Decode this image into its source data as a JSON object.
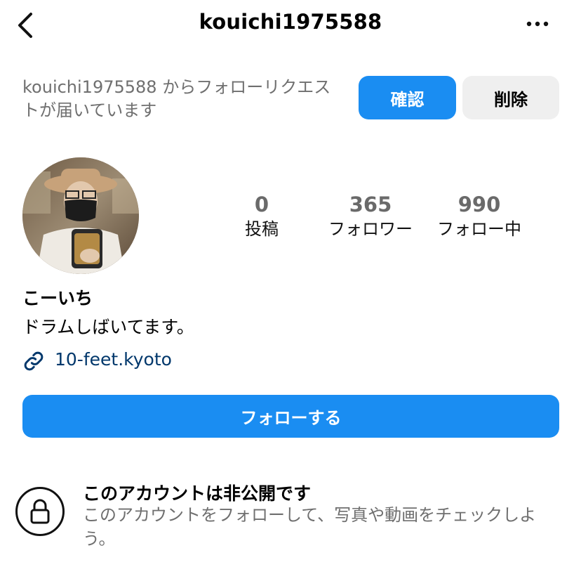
{
  "header": {
    "title": "kouichi1975588",
    "back_icon": "chevron-left-icon",
    "more_icon": "more-horizontal-icon"
  },
  "follow_request": {
    "message": "kouichi1975588 からフォローリクエストが届いています",
    "confirm_label": "確認",
    "delete_label": "削除"
  },
  "profile": {
    "stats": {
      "posts_count": "0",
      "posts_label": "投稿",
      "followers_count": "365",
      "followers_label": "フォロワー",
      "following_count": "990",
      "following_label": "フォロー中"
    },
    "display_name": "こーいち",
    "bio": "ドラムしばいてます。",
    "link": "10-feet.kyoto",
    "link_icon": "link-icon"
  },
  "actions": {
    "follow_label": "フォローする"
  },
  "private_notice": {
    "icon": "lock-icon",
    "title": "このアカウントは非公開です",
    "description": "このアカウントをフォローして、写真や動画をチェックしよう。"
  },
  "colors": {
    "accent": "#1a8df2",
    "secondary_button": "#efefef",
    "muted_text": "#6f6f6f",
    "link_text": "#00376b"
  }
}
